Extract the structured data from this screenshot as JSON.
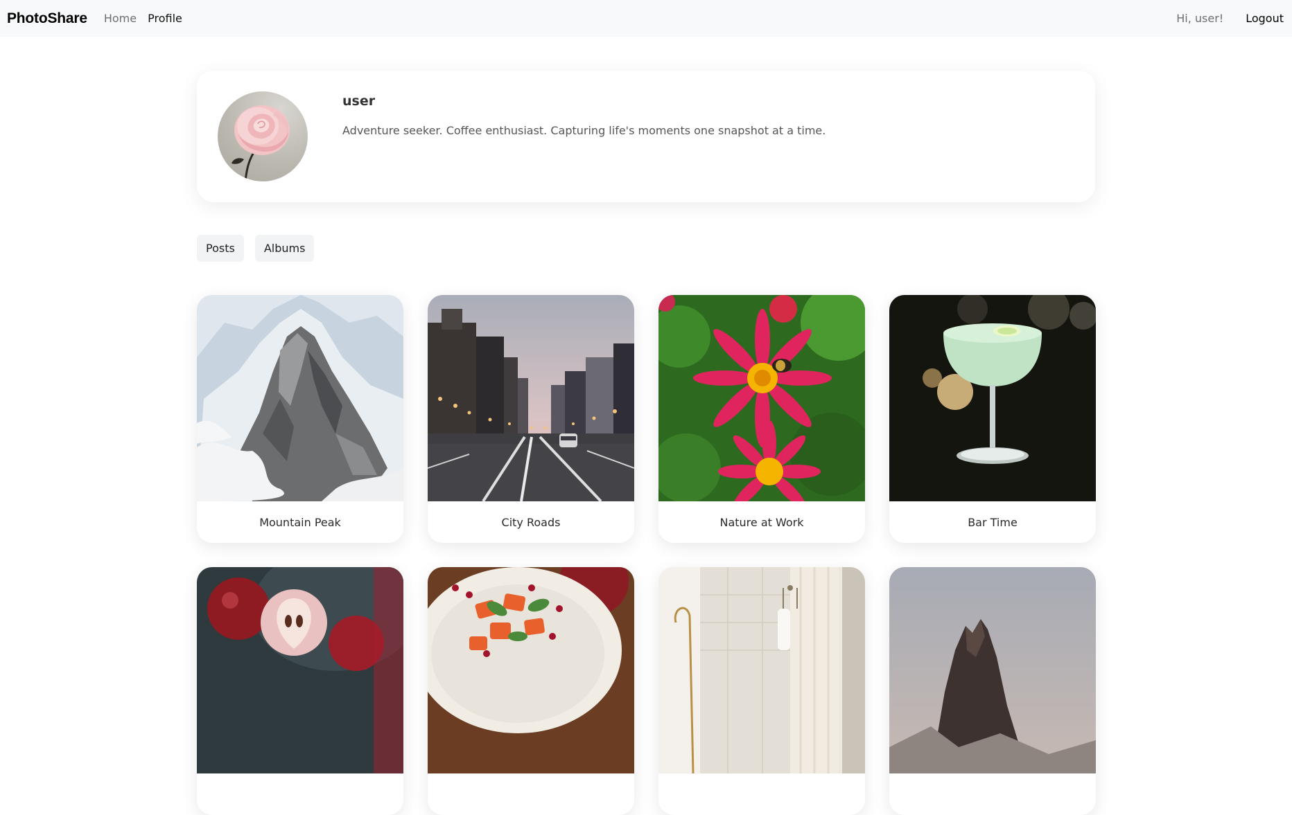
{
  "navbar": {
    "brand": "PhotoShare",
    "links": [
      {
        "label": "Home"
      },
      {
        "label": "Profile"
      }
    ],
    "greeting": "Hi, user!",
    "logout_label": "Logout"
  },
  "profile": {
    "username": "user",
    "bio": "Adventure seeker. Coffee enthusiast. Capturing life's moments one snapshot at a time.",
    "avatar_icon": "pink-rose-photo"
  },
  "tabs": [
    {
      "label": "Posts"
    },
    {
      "label": "Albums"
    }
  ],
  "posts": [
    {
      "title": "Mountain Peak",
      "image": "snowy-mountain-photo"
    },
    {
      "title": "City Roads",
      "image": "city-street-photo"
    },
    {
      "title": "Nature at Work",
      "image": "flower-bee-photo"
    },
    {
      "title": "Bar Time",
      "image": "cocktail-glass-photo"
    },
    {
      "title": "",
      "image": "apples-photo"
    },
    {
      "title": "",
      "image": "salad-plate-photo"
    },
    {
      "title": "",
      "image": "bathroom-interior-photo"
    },
    {
      "title": "",
      "image": "rock-peak-photo"
    }
  ],
  "colors": {
    "navbar_bg": "#f8f9fa",
    "tab_bg": "#f2f3f5",
    "flower_pink": "#e0245e",
    "flower_center": "#f5b400"
  }
}
